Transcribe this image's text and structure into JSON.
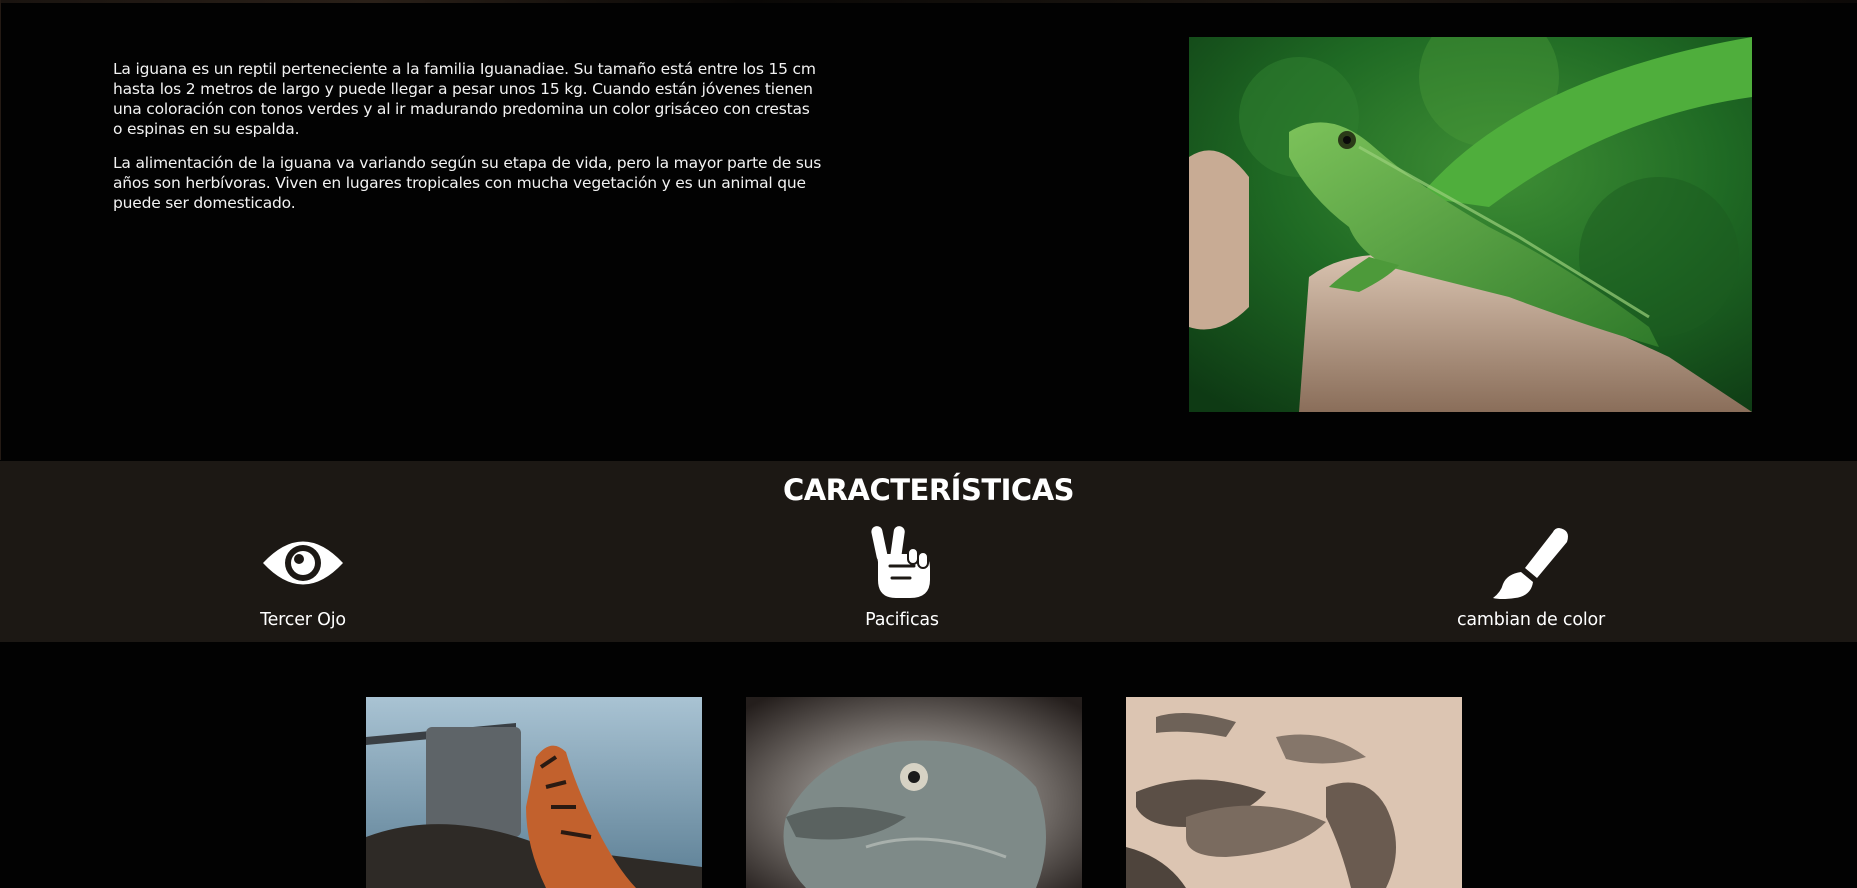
{
  "intro": {
    "paragraph_1": "La iguana es un reptil perteneciente a la familia Iguanadiae. Su tamaño está entre los 15 cm hasta los 2 metros de largo y puede llegar a pesar unos 15 kg. Cuando están jóvenes tienen una coloración con tonos verdes y al ir madurando predomina un color grisáceo con crestas o espinas en su espalda.",
    "paragraph_2": "La alimentación de la iguana va variando según su etapa de vida, pero la mayor parte de sus años son herbívoras. Viven en lugares tropicales con mucha vegetación y es un animal que puede ser domesticado."
  },
  "features": {
    "title": "CARACTERÍSTICAS",
    "items": [
      {
        "label": "Tercer Ojo",
        "icon": "eye-icon"
      },
      {
        "label": "Pacificas",
        "icon": "peace-hand-icon"
      },
      {
        "label": "cambian de color",
        "icon": "paintbrush-icon"
      }
    ]
  },
  "colors": {
    "background": "#020202",
    "features_band": "#1c1814",
    "text": "#ffffff"
  }
}
